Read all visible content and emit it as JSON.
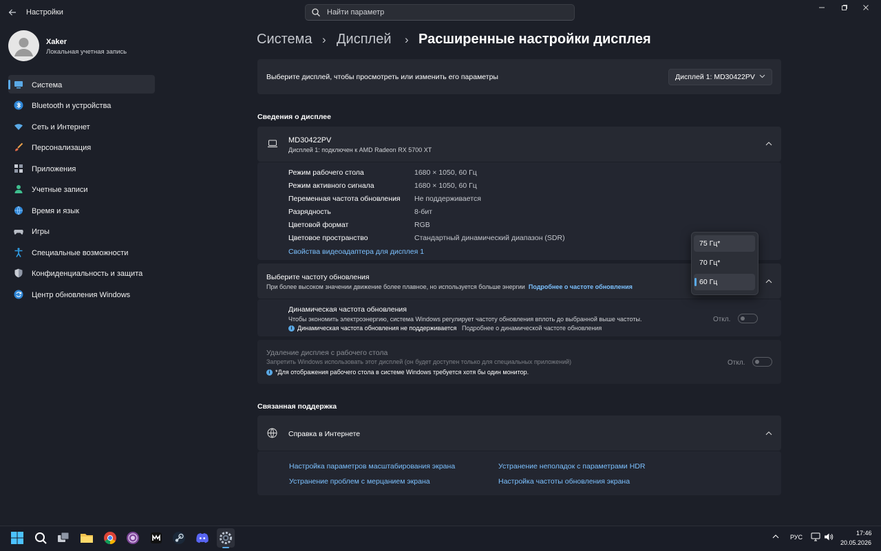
{
  "app_title": "Настройки",
  "search": {
    "placeholder": "Найти параметр"
  },
  "user": {
    "name": "Xaker",
    "account_type": "Локальная учетная запись"
  },
  "sidebar": {
    "items": [
      {
        "label": "Система",
        "icon": "system-icon",
        "active": true
      },
      {
        "label": "Bluetooth и устройства",
        "icon": "bluetooth-icon"
      },
      {
        "label": "Сеть и Интернет",
        "icon": "wifi-icon"
      },
      {
        "label": "Персонализация",
        "icon": "brush-icon"
      },
      {
        "label": "Приложения",
        "icon": "apps-icon"
      },
      {
        "label": "Учетные записи",
        "icon": "person-icon"
      },
      {
        "label": "Время и язык",
        "icon": "globe-clock-icon"
      },
      {
        "label": "Игры",
        "icon": "gamepad-icon"
      },
      {
        "label": "Специальные возможности",
        "icon": "accessibility-icon"
      },
      {
        "label": "Конфиденциальность и защита",
        "icon": "shield-icon"
      },
      {
        "label": "Центр обновления Windows",
        "icon": "update-icon"
      }
    ]
  },
  "breadcrumb": {
    "level1": "Система",
    "level2": "Дисплей",
    "current": "Расширенные настройки дисплея"
  },
  "display_select": {
    "prompt": "Выберите дисплей, чтобы просмотреть или изменить его параметры",
    "value": "Дисплей 1: MD30422PV"
  },
  "display_info": {
    "section_title": "Сведения о дисплее",
    "monitor_name": "MD30422PV",
    "monitor_sub": "Дисплей 1: подключен к AMD Radeon RX 5700 XT",
    "rows": [
      {
        "label": "Режим рабочего стола",
        "value": "1680 × 1050, 60 Гц"
      },
      {
        "label": "Режим активного сигнала",
        "value": "1680 × 1050, 60 Гц"
      },
      {
        "label": "Переменная частота обновления",
        "value": "Не поддерживается"
      },
      {
        "label": "Разрядность",
        "value": "8-бит"
      },
      {
        "label": "Цветовой формат",
        "value": "RGB"
      },
      {
        "label": "Цветовое пространство",
        "value": "Стандартный динамический диапазон (SDR)"
      }
    ],
    "adapter_link": "Свойства видеоадаптера для дисплея 1"
  },
  "refresh_rate": {
    "title": "Выберите частоту обновления",
    "desc": "При более высоком значении движение более плавное, но используется больше энергии",
    "link": "Подробнее о частоте обновления",
    "options": [
      "75 Гц*",
      "70 Гц*",
      "60 Гц"
    ],
    "selected": "60 Гц"
  },
  "dynamic_refresh": {
    "title": "Динамическая частота обновления",
    "desc": "Чтобы экономить электроэнергию, система Windows регулирует частоту обновления вплоть до выбранной выше частоты.",
    "note": "Динамическая частота обновления не поддерживается",
    "link": "Подробнее о динамической частоте обновления",
    "state": "Откл."
  },
  "remove_display": {
    "title": "Удаление дисплея с рабочего стола",
    "desc": "Запретить Windows использовать этот дисплей (он будет доступен только для специальных приложений)",
    "note": "*Для отображения рабочего стола в системе Windows требуется хотя бы один монитор.",
    "state": "Откл."
  },
  "support": {
    "section_title": "Связанная поддержка",
    "card_title": "Справка в Интернете",
    "links": [
      "Настройка параметров масштабирования экрана",
      "Устранение неполадок с параметрами HDR",
      "Устранение проблем с мерцанием экрана",
      "Настройка частоты обновления экрана"
    ]
  },
  "taskbar": {
    "lang": "РУС",
    "time": "17:46",
    "date": "20.05.2026",
    "apps": [
      "start-icon",
      "search-icon",
      "task-view-icon",
      "file-explorer-icon",
      "chrome-icon",
      "tor-browser-icon",
      "epic-games-icon",
      "steam-icon",
      "discord-icon",
      "settings-gear-icon"
    ]
  },
  "colors": {
    "accent": "#5aa9e6",
    "link": "#7cc1ff",
    "background": "#1c1f28",
    "card": "#262932"
  }
}
